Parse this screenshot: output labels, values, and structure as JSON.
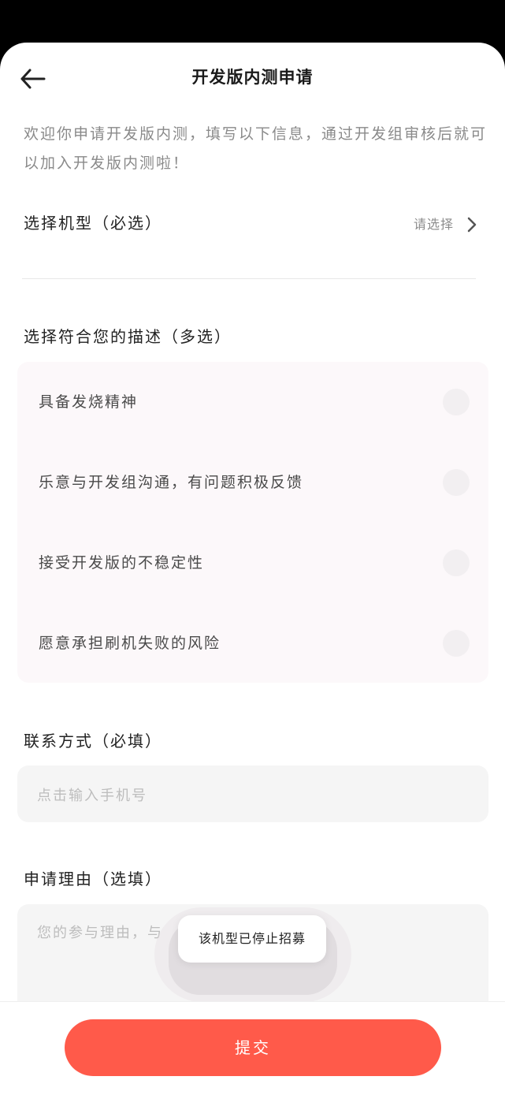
{
  "header": {
    "title": "开发版内测申请"
  },
  "intro": "欢迎你申请开发版内测，填写以下信息，通过开发组审核后就可以加入开发版内测啦！",
  "model": {
    "label": "选择机型（必选）",
    "value_placeholder": "请选择"
  },
  "description": {
    "label": "选择符合您的描述（多选）",
    "options": [
      {
        "label": "具备发烧精神",
        "checked": false
      },
      {
        "label": "乐意与开发组沟通，有问题积极反馈",
        "checked": false
      },
      {
        "label": "接受开发版的不稳定性",
        "checked": false
      },
      {
        "label": "愿意承担刷机失败的风险",
        "checked": false
      }
    ]
  },
  "contact": {
    "label": "联系方式（必填）",
    "placeholder": "点击输入手机号"
  },
  "reason": {
    "label": "申请理由（选填）",
    "placeholder": "您的参与理由，与"
  },
  "toast": {
    "message": "该机型已停止招募"
  },
  "submit": {
    "label": "提交"
  },
  "colors": {
    "accent": "#ff5a4a",
    "option_bg": "#fcf8fa",
    "input_bg": "#f5f5f5"
  }
}
